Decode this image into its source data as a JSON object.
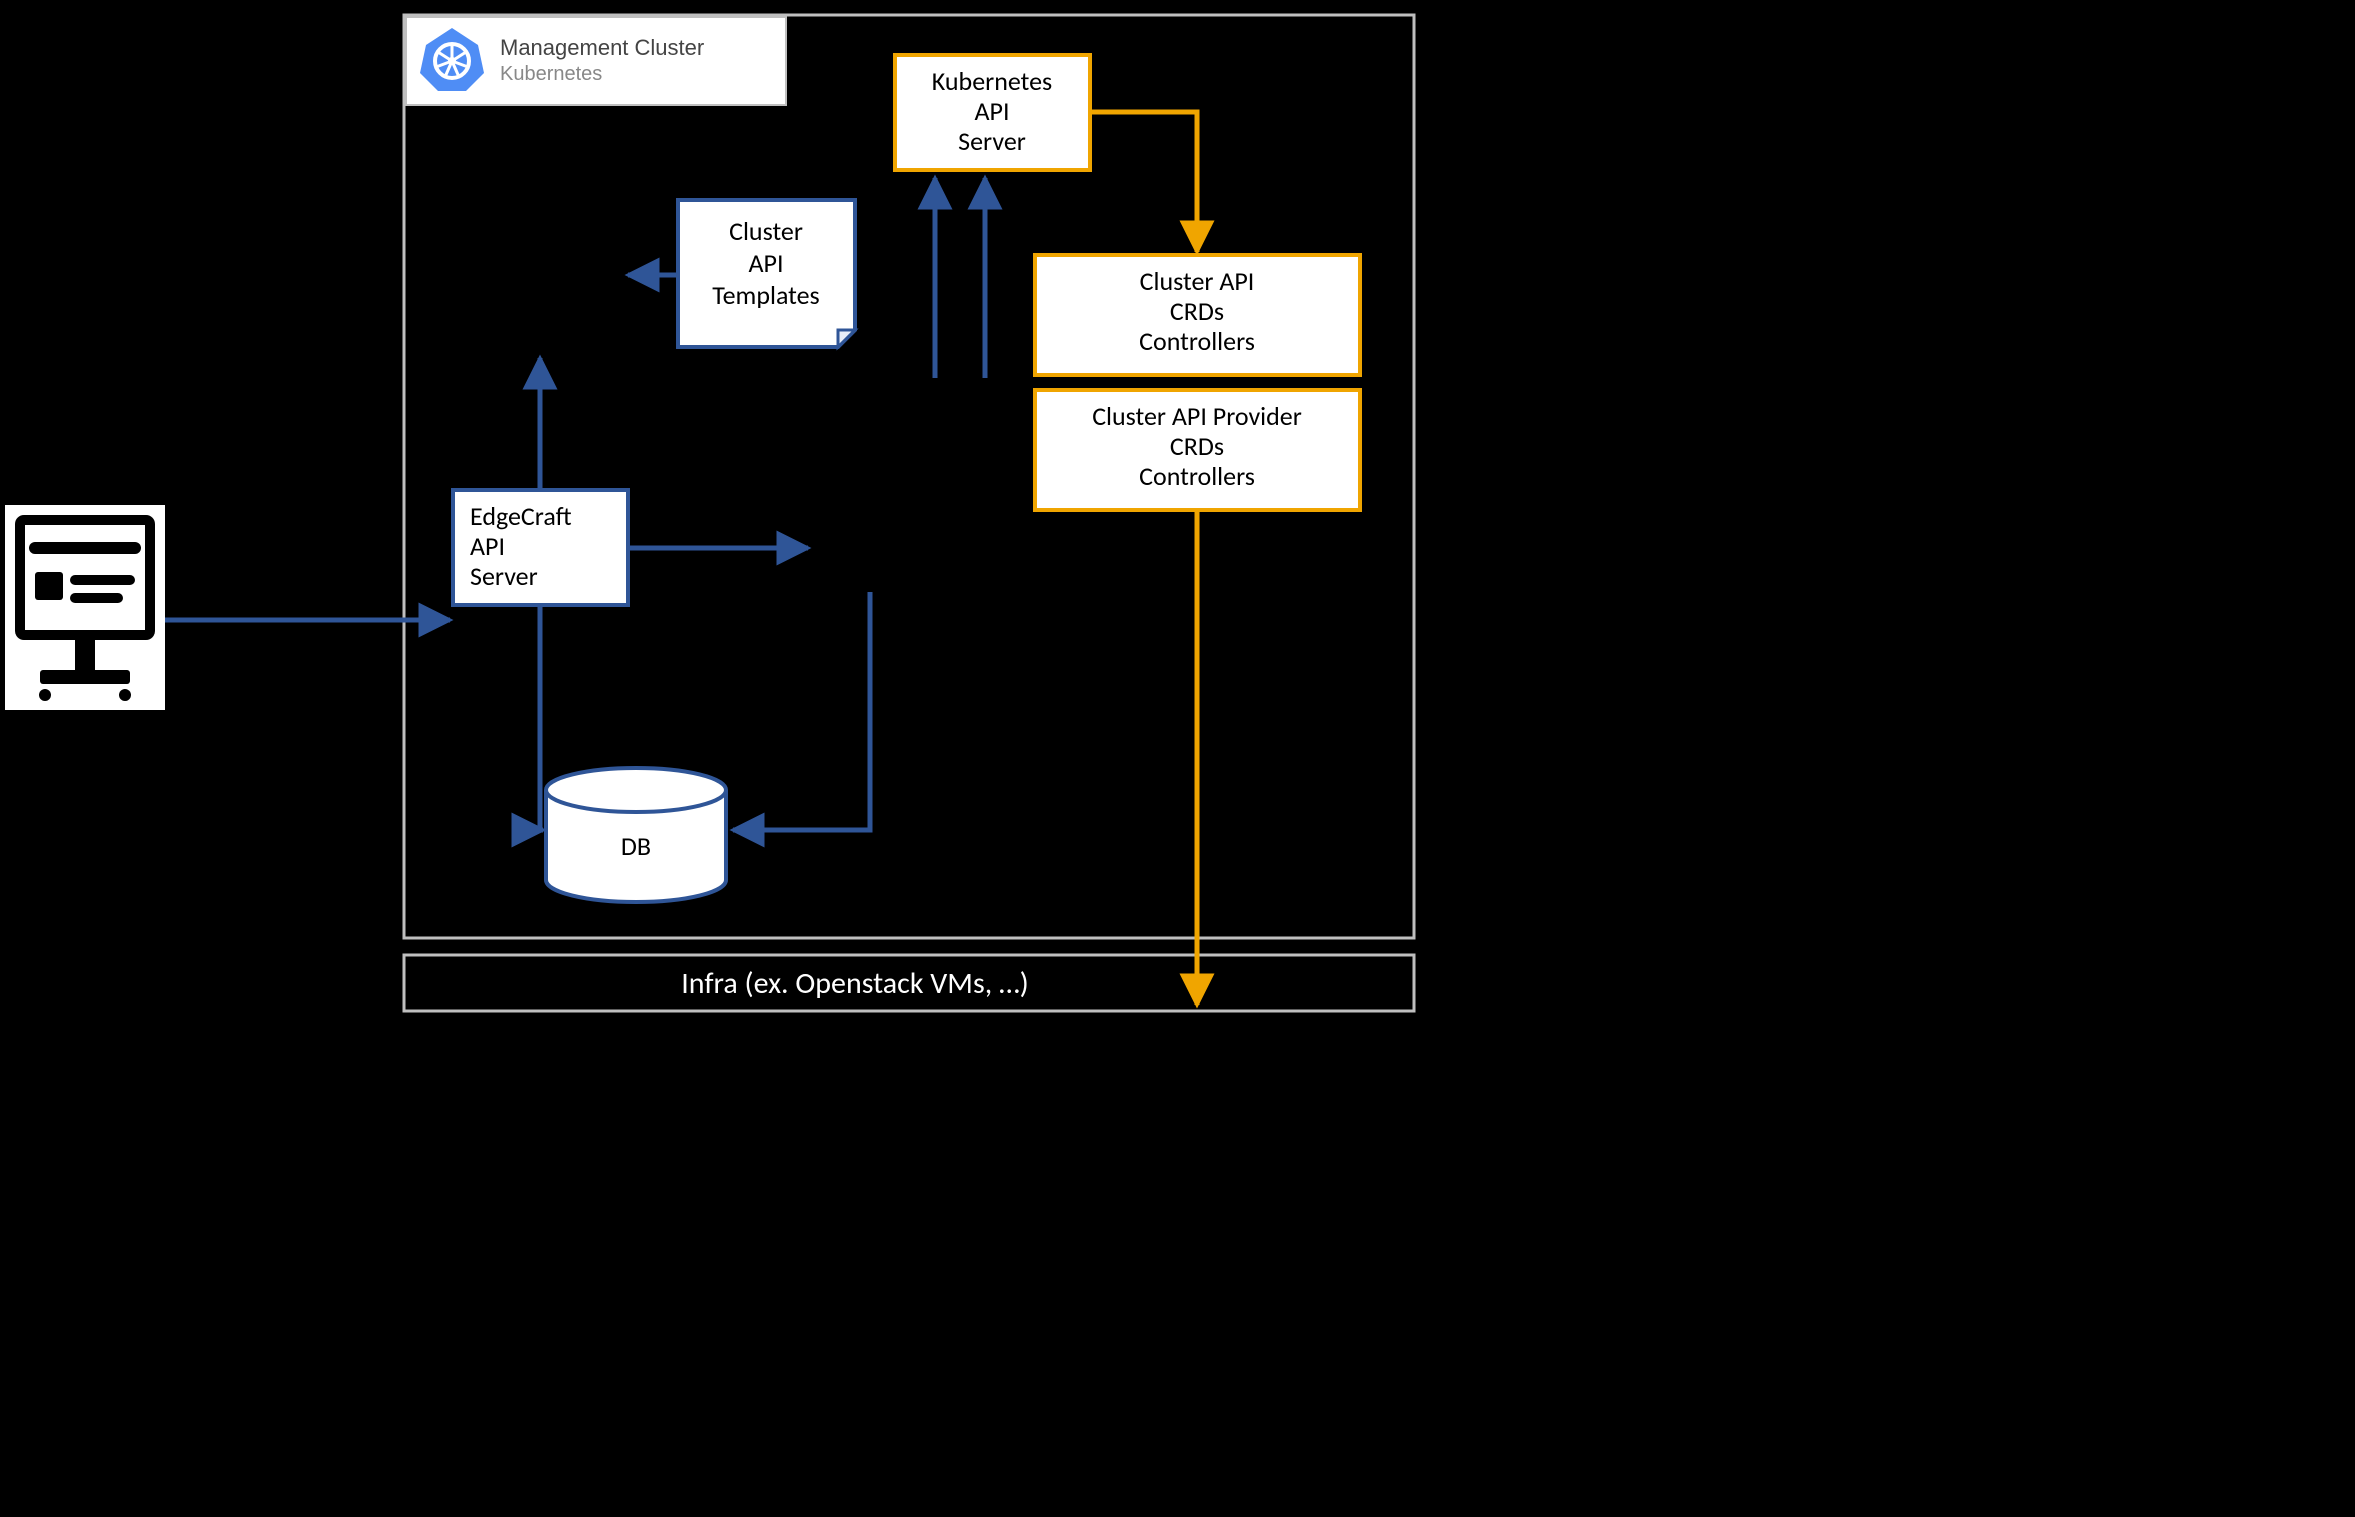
{
  "header": {
    "title": "Management Cluster",
    "subtitle": "Kubernetes"
  },
  "nodes": {
    "k8s_api": {
      "l1": "Kubernetes",
      "l2": "API",
      "l3": "Server"
    },
    "capi_crds": {
      "l1": "Cluster API",
      "l2": "CRDs",
      "l3": "Controllers"
    },
    "capi_prov": {
      "l1": "Cluster API Provider",
      "l2": "CRDs",
      "l3": "Controllers"
    },
    "templates": {
      "l1": "Cluster",
      "l2": "API",
      "l3": "Templates"
    },
    "edgecraft": {
      "l1": "EdgeCraft",
      "l2": "API",
      "l3": "Server"
    },
    "db": {
      "label": "DB"
    }
  },
  "infra": {
    "label": "Infra (ex. Openstack VMs, …)"
  }
}
